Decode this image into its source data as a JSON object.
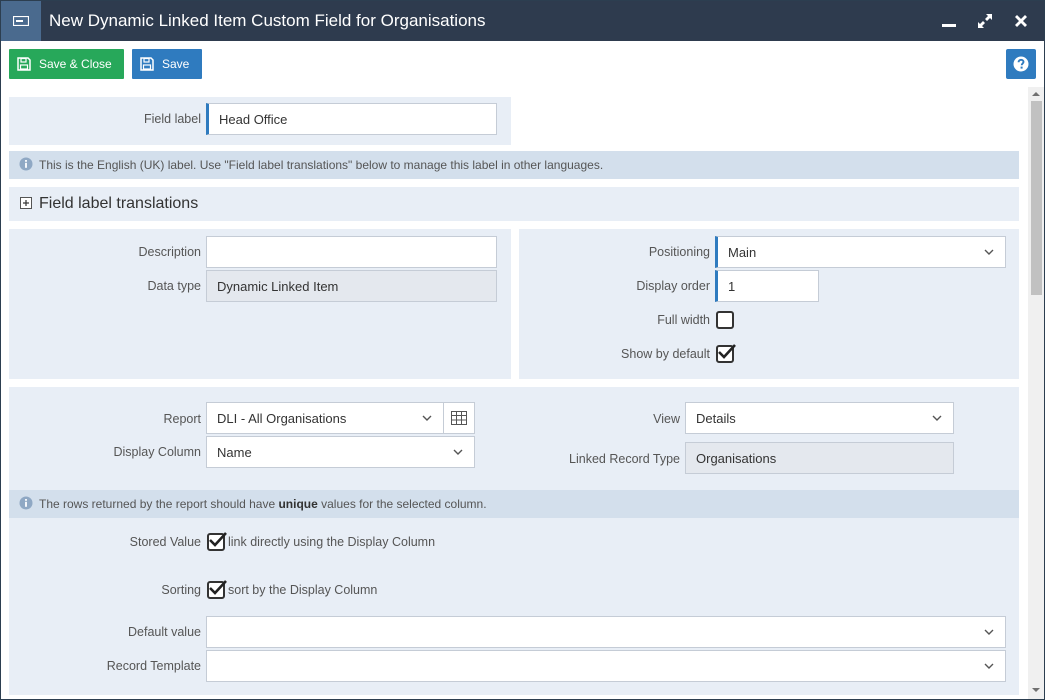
{
  "window": {
    "title": "New Dynamic Linked Item Custom Field for Organisations"
  },
  "toolbar": {
    "save_close_label": "Save & Close",
    "save_label": "Save"
  },
  "field_label": {
    "label": "Field label",
    "value": "Head Office"
  },
  "info_label": {
    "text": "This is the English (UK) label. Use \"Field label translations\" below to manage this label in other languages."
  },
  "translations": {
    "header": "Field label translations"
  },
  "details": {
    "description_label": "Description",
    "description_value": "",
    "data_type_label": "Data type",
    "data_type_value": "Dynamic Linked Item",
    "positioning_label": "Positioning",
    "positioning_value": "Main",
    "display_order_label": "Display order",
    "display_order_value": "1",
    "full_width_label": "Full width",
    "show_by_default_label": "Show by default"
  },
  "report": {
    "report_label": "Report",
    "report_value": "DLI - All Organisations",
    "display_column_label": "Display Column",
    "display_column_value": "Name",
    "view_label": "View",
    "view_value": "Details",
    "linked_record_type_label": "Linked Record Type",
    "linked_record_type_value": "Organisations"
  },
  "info_unique": {
    "prefix": "The rows returned by the report should have ",
    "bold": "unique",
    "suffix": " values for the selected column."
  },
  "options": {
    "stored_value_label": "Stored Value",
    "stored_value_text": "link directly using the Display Column",
    "sorting_label": "Sorting",
    "sorting_text": "sort by the Display Column",
    "default_value_label": "Default value",
    "default_value_value": "",
    "record_template_label": "Record Template",
    "record_template_value": ""
  },
  "colors": {
    "titlebar": "#2e3b4e",
    "green": "#27a85a",
    "blue": "#2f7bbf",
    "panel": "#e8eef6",
    "info": "#d3dfec"
  }
}
